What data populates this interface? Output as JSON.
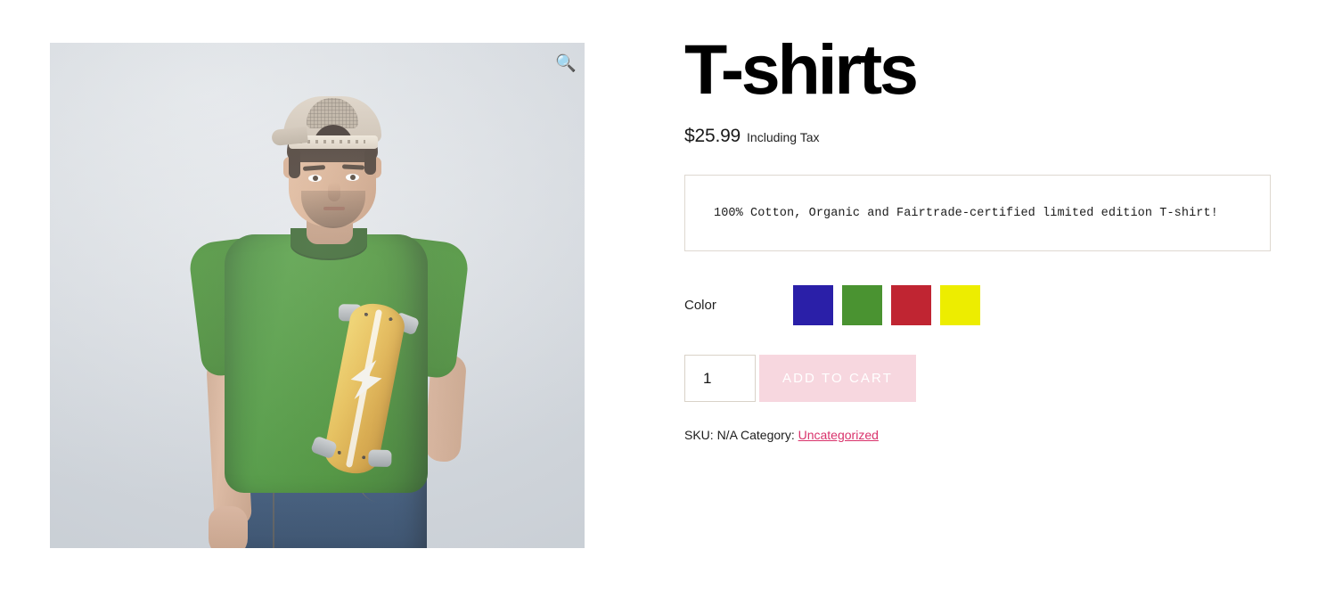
{
  "product": {
    "title": "T-shirts",
    "price_amount": "$25.99",
    "price_suffix": "Including Tax",
    "description": "100% Cotton, Organic and Fairtrade-certified limited edition T-shirt!"
  },
  "gallery": {
    "zoom_icon": "magnifier-icon",
    "zoom_glyph": "🔍",
    "image_alt": "Man in backwards cap wearing a green t-shirt with a yellow longboard skateboard and lightning bolt print",
    "background_color": "#dfe3e7",
    "shirt_color": "#35861f",
    "board_color": "#e8b93f",
    "jeans_color": "#27456a"
  },
  "variations": {
    "attribute_label": "Color",
    "options": [
      {
        "name": "Blue",
        "hex": "#2a1fa8"
      },
      {
        "name": "Green",
        "hex": "#4a9331"
      },
      {
        "name": "Red",
        "hex": "#c02532"
      },
      {
        "name": "Yellow",
        "hex": "#eded00"
      }
    ]
  },
  "cart": {
    "quantity_value": "1",
    "quantity_placeholder": "1",
    "add_to_cart_label": "ADD TO CART",
    "button_color": "#f7d7df"
  },
  "meta": {
    "sku_text": "SKU: N/A Category:",
    "category_link": "Uncategorized",
    "link_color": "#d9326b"
  }
}
